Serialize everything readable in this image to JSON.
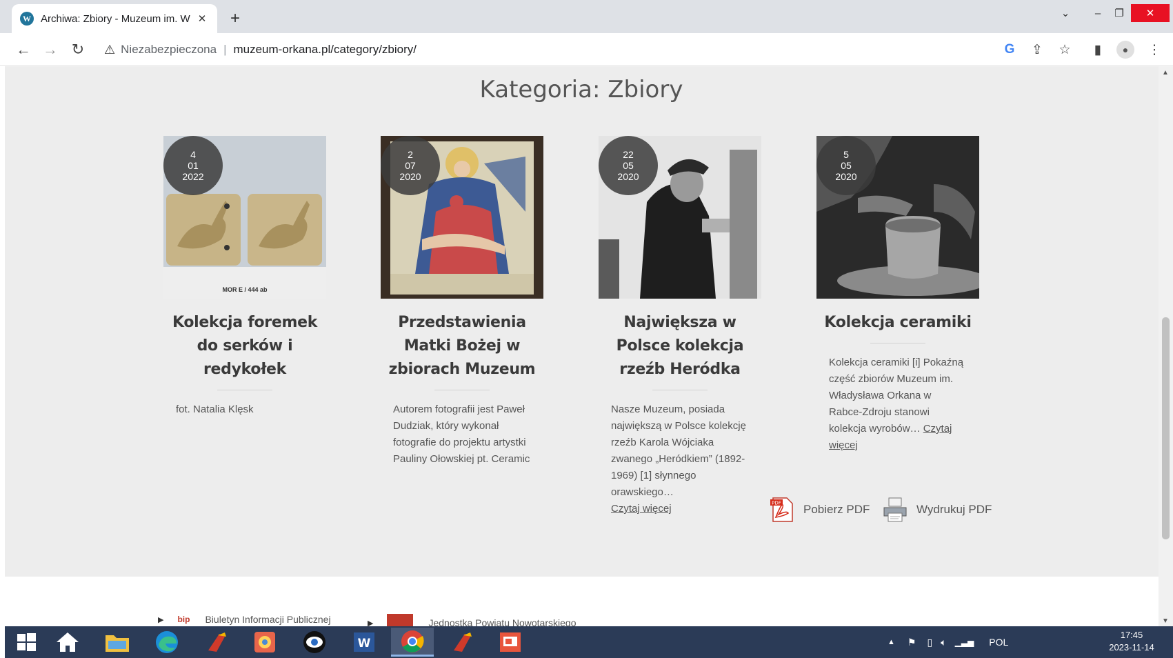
{
  "browser": {
    "tab_title": "Archiwa: Zbiory - Muzeum im. W",
    "new_tab_label": "+",
    "security_label": "Niezabezpieczona",
    "url": "muzeum-orkana.pl/category/zbiory/"
  },
  "page": {
    "title": "Kategoria: Zbiory"
  },
  "posts": [
    {
      "day": "4",
      "month": "01",
      "year": "2022",
      "title": "Kolekcja foremek do serków i redykołek",
      "excerpt": "fot. Natalia Klęsk",
      "image_caption": "MOR E / 444 ab",
      "read_more": ""
    },
    {
      "day": "2",
      "month": "07",
      "year": "2020",
      "title": "Przedstawienia Matki Bożej w zbiorach Muzeum",
      "excerpt": "Autorem fotografii jest Paweł Dudziak, który wykonał fotografie do projektu artystki Pauliny Ołowskiej pt. Ceramic",
      "image_caption": "",
      "read_more": ""
    },
    {
      "day": "22",
      "month": "05",
      "year": "2020",
      "title": "Największa w Polsce kolekcja rzeźb Heródka",
      "excerpt": "Nasze Muzeum, posiada największą w Polsce kolekcję rzeźb Karola Wójciaka zwanego „Heródkiem” (1892-1969) [1] słynnego orawskiego…",
      "image_caption": "",
      "read_more": "Czytaj więcej"
    },
    {
      "day": "5",
      "month": "05",
      "year": "2020",
      "title": "Kolekcja ceramiki",
      "excerpt": "Kolekcja ceramiki [i] Pokaźną część zbiorów Muzeum im. Władysława Orkana w Rabce-Zdroju stanowi kolekcja wyrobów…",
      "image_caption": "",
      "read_more": "Czytaj więcej"
    }
  ],
  "actions": {
    "download_pdf": "Pobierz PDF",
    "print_pdf": "Wydrukuj PDF",
    "pdf_badge": "PDF"
  },
  "footer": {
    "bip_logo": "bip",
    "link1": "Biuletyn Informacji Publicznej",
    "link2": "Jednostka Powiatu Nowotarskiego"
  },
  "taskbar": {
    "language": "POL",
    "time": "17:45",
    "date": "2023-11-14"
  },
  "colors": {
    "page_bg": "#ededed",
    "badge_bg": "#3c3c3c",
    "taskbar_bg": "#2b3b57",
    "close_red": "#e81123"
  }
}
